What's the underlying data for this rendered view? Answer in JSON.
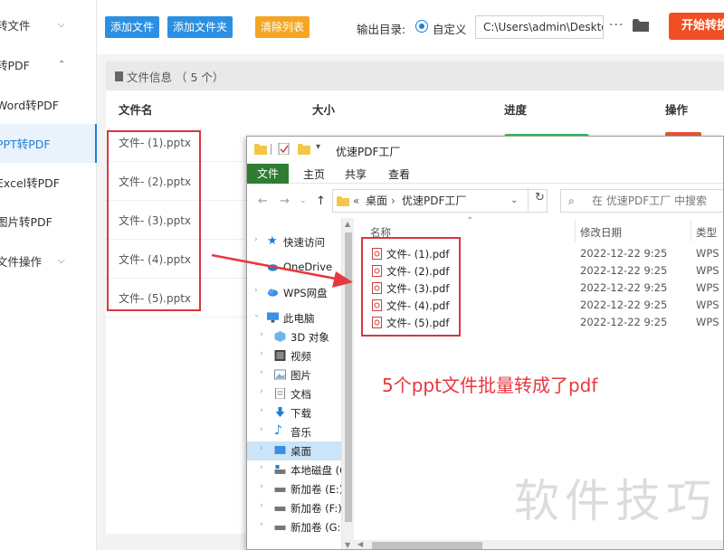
{
  "sidebar": {
    "items": [
      {
        "label": "转文件",
        "chevron": "v"
      },
      {
        "label": "转PDF",
        "chevron": "^"
      },
      {
        "label": "Word转PDF",
        "chevron": ""
      },
      {
        "label": "PPT转PDF",
        "chevron": ""
      },
      {
        "label": "Excel转PDF",
        "chevron": ""
      },
      {
        "label": "图片转PDF",
        "chevron": ""
      },
      {
        "label": "文件操作",
        "chevron": "v"
      }
    ]
  },
  "toolbar": {
    "add_file": "添加文件",
    "add_folder": "添加文件夹",
    "clear_list": "清除列表",
    "output_label": "输出目录:",
    "custom_option": "自定义",
    "output_path": "C:\\Users\\admin\\Deskto",
    "more": "···",
    "start": "开始转换"
  },
  "file_info": {
    "title": "文件信息 （ 5 个）"
  },
  "table": {
    "columns": [
      "文件名",
      "大小",
      "进度",
      "操作"
    ],
    "rows": [
      {
        "name": "文件- (1).pptx"
      },
      {
        "name": "文件- (2).pptx"
      },
      {
        "name": "文件- (3).pptx"
      },
      {
        "name": "文件- (4).pptx"
      },
      {
        "name": "文件- (5).pptx"
      }
    ]
  },
  "explorer": {
    "title": "优速PDF工厂",
    "ribbon": [
      "文件",
      "主页",
      "共享",
      "查看"
    ],
    "address": {
      "prefix": "«",
      "parts": [
        "桌面",
        "优速PDF工厂"
      ],
      "separator": "›"
    },
    "search_placeholder": "在 优速PDF工厂 中搜索",
    "nav": [
      {
        "label": "快速访问",
        "icon": "star-icon"
      },
      {
        "label": "OneDrive",
        "icon": "cloud-icon"
      },
      {
        "label": "WPS网盘",
        "icon": "cloud-icon"
      },
      {
        "label": "此电脑",
        "icon": "computer-icon"
      },
      {
        "label": "3D 对象",
        "icon": "cube-icon"
      },
      {
        "label": "视频",
        "icon": "video-icon"
      },
      {
        "label": "图片",
        "icon": "image-icon"
      },
      {
        "label": "文档",
        "icon": "document-icon"
      },
      {
        "label": "下载",
        "icon": "download-icon"
      },
      {
        "label": "音乐",
        "icon": "music-icon"
      },
      {
        "label": "桌面",
        "icon": "folder-icon"
      },
      {
        "label": "本地磁盘 (C",
        "icon": "drive-icon"
      },
      {
        "label": "新加卷 (E:)",
        "icon": "drive-icon"
      },
      {
        "label": "新加卷 (F:)",
        "icon": "drive-icon"
      },
      {
        "label": "新加卷 (G:)",
        "icon": "drive-icon"
      }
    ],
    "columns": [
      "名称",
      "修改日期",
      "类型"
    ],
    "files": [
      {
        "name": "文件- (1).pdf",
        "date": "2022-12-22 9:25",
        "type": "WPS P"
      },
      {
        "name": "文件- (2).pdf",
        "date": "2022-12-22 9:25",
        "type": "WPS P"
      },
      {
        "name": "文件- (3).pdf",
        "date": "2022-12-22 9:25",
        "type": "WPS P"
      },
      {
        "name": "文件- (4).pdf",
        "date": "2022-12-22 9:25",
        "type": "WPS P"
      },
      {
        "name": "文件- (5).pdf",
        "date": "2022-12-22 9:25",
        "type": "WPS P"
      }
    ]
  },
  "annotation": "5个ppt文件批量转成了pdf",
  "watermark": "软件技巧",
  "colors": {
    "accent_blue": "#2b8fe3",
    "clear_orange": "#f4a623",
    "start_red": "#f04e23",
    "highlight_red": "#d9363e",
    "explorer_file_tab": "#2e7d32"
  }
}
